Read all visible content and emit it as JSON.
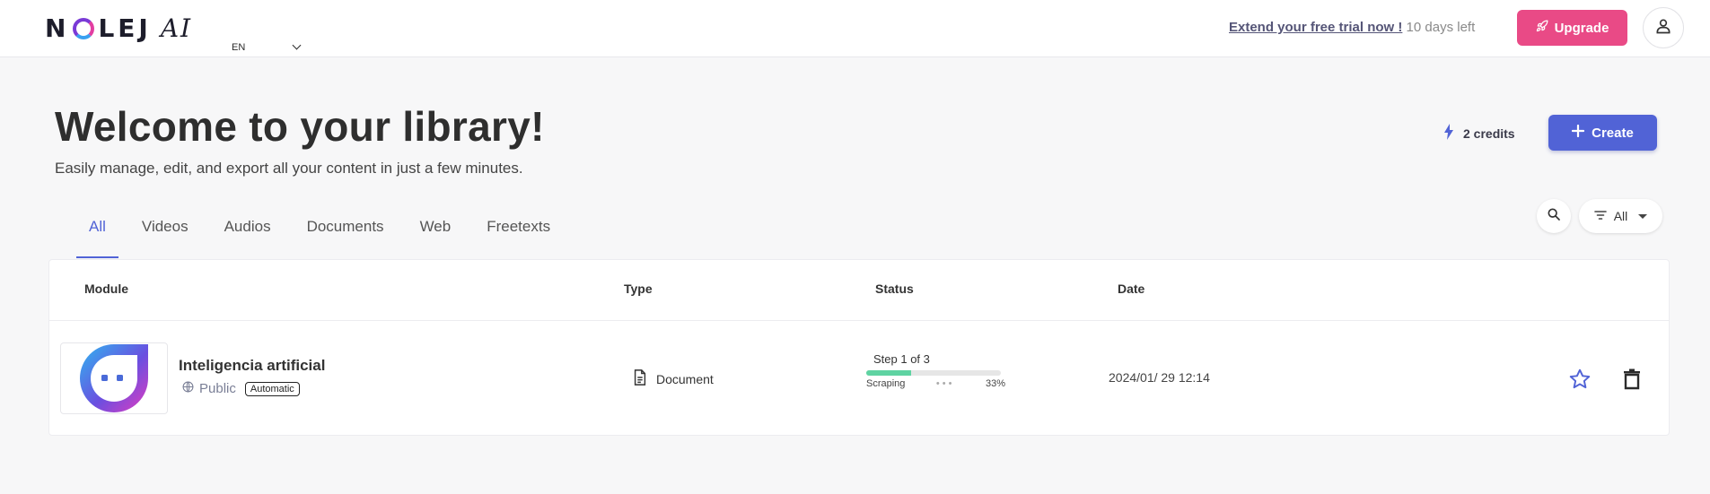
{
  "header": {
    "logo_text": "NOLEJ",
    "logo_suffix": "AI",
    "language": "EN",
    "trial_link": "Extend your free trial now !",
    "trial_remaining": "10 days left",
    "upgrade_label": "Upgrade",
    "colors": {
      "upgrade": "#e94a86",
      "accent": "#5163d6"
    }
  },
  "page": {
    "title": "Welcome to your library!",
    "subtitle": "Easily manage, edit, and export all your content in just a few minutes.",
    "credits": "2 credits",
    "create_label": "Create"
  },
  "tabs": [
    {
      "label": "All",
      "active": true
    },
    {
      "label": "Videos"
    },
    {
      "label": "Audios"
    },
    {
      "label": "Documents"
    },
    {
      "label": "Web"
    },
    {
      "label": "Freetexts"
    }
  ],
  "filter": {
    "label": "All"
  },
  "table": {
    "columns": [
      "Module",
      "Type",
      "Status",
      "Date"
    ],
    "rows": [
      {
        "title": "Inteligencia artificial",
        "visibility": "Public",
        "badge": "Automatic",
        "type": "Document",
        "step": "Step 1 of 3",
        "stage": "Scraping",
        "progress_label": "33%",
        "progress": 0.33,
        "date": "2024/01/ 29 12:14"
      }
    ]
  },
  "icons": {
    "upgrade": "rocket-icon",
    "avatar": "user-icon",
    "credits": "bolt-icon",
    "create": "plus-icon",
    "search": "search-icon",
    "filter": "filter-icon",
    "visibility": "globe-icon",
    "type": "document-icon",
    "favorite": "star-icon",
    "delete": "trash-icon"
  }
}
